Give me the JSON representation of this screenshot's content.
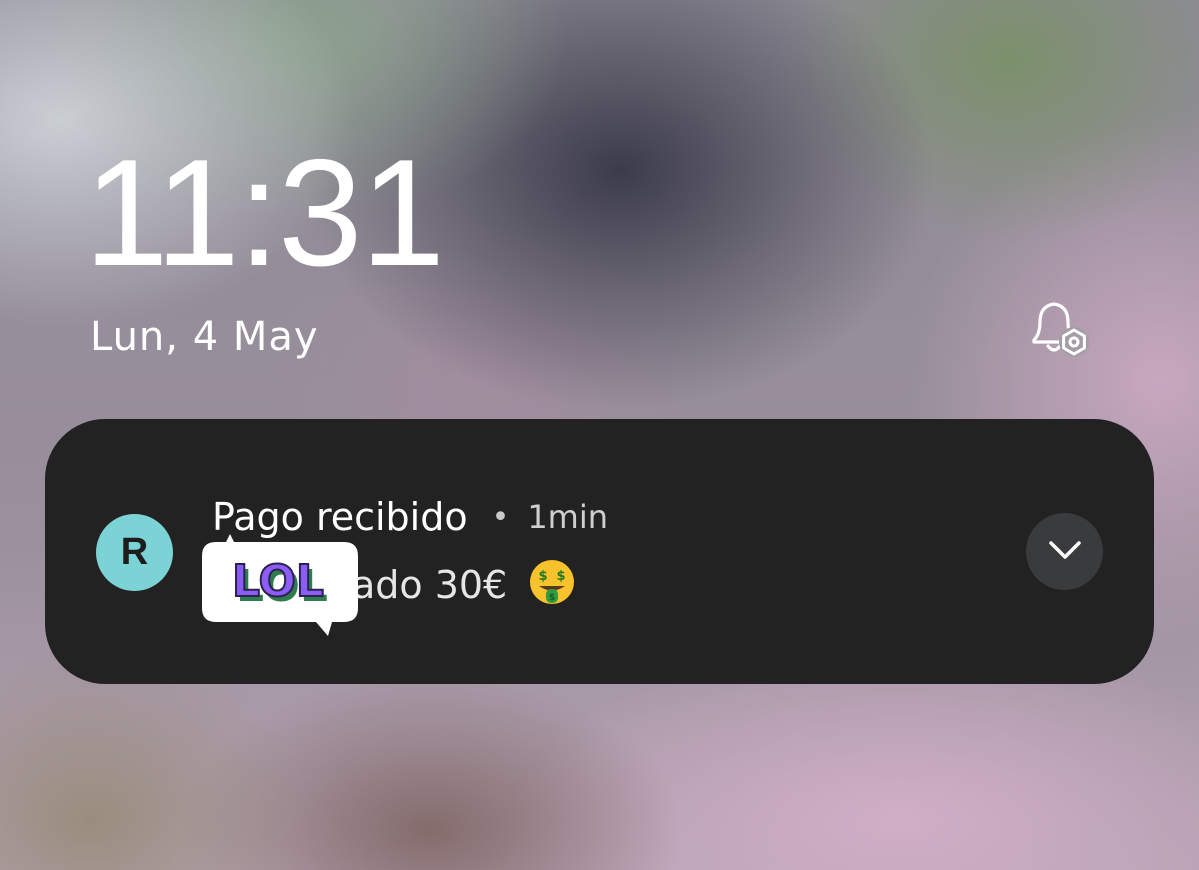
{
  "lockscreen": {
    "time": "11:31",
    "date": "Lun, 4 May",
    "notification_settings_icon": "bell-gear-icon"
  },
  "notification": {
    "app_icon_letter": "R",
    "app_icon_color": "#7cd3d6",
    "title": "Pago recibido",
    "separator": "•",
    "timestamp": "1min",
    "body": "ha enviado 30€",
    "body_emoji": "money-mouth-face-icon",
    "expand_icon": "chevron-down-icon",
    "sticker_text": "LOL",
    "sticker_color": "#8b5cf6",
    "card_color": "#222222"
  }
}
